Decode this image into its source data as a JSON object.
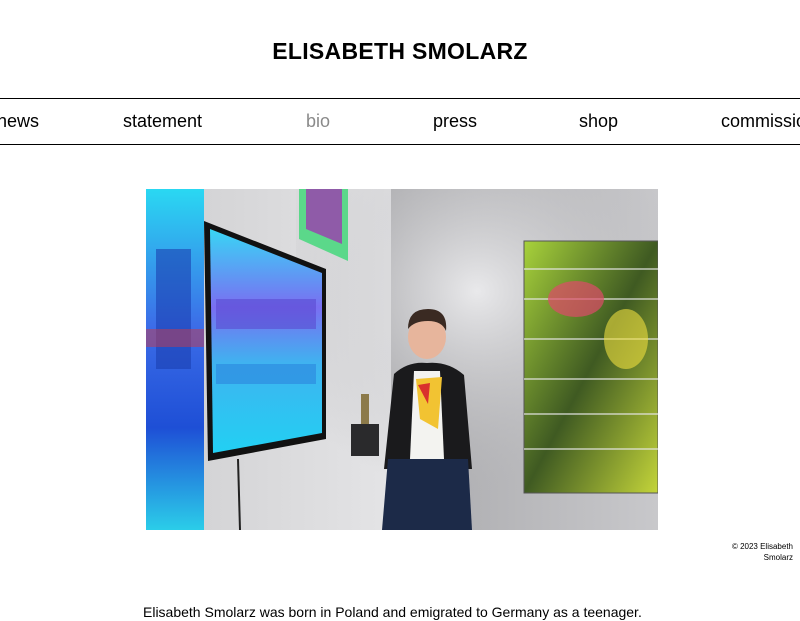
{
  "site": {
    "title": "ELISABETH SMOLARZ"
  },
  "nav": {
    "items": [
      {
        "label": "news",
        "active": false
      },
      {
        "label": "statement",
        "active": false
      },
      {
        "label": "bio",
        "active": true
      },
      {
        "label": "press",
        "active": false
      },
      {
        "label": "shop",
        "active": false
      },
      {
        "label": "commissions",
        "active": false
      }
    ]
  },
  "photo": {
    "credit": "© 2023 Elisabeth Smolarz"
  },
  "bio": {
    "first_line": "Elisabeth Smolarz was born in Poland and emigrated to Germany as a teenager."
  },
  "colors": {
    "text": "#000000",
    "nav_active": "#8a8a8a",
    "background": "#ffffff"
  }
}
